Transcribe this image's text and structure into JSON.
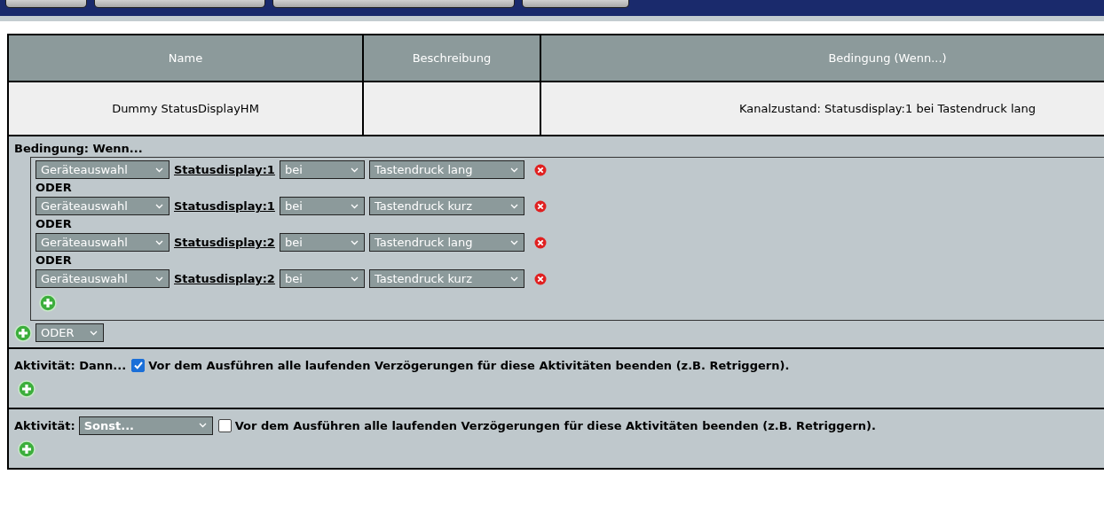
{
  "table": {
    "columns": [
      "Name",
      "Beschreibung",
      "Bedingung (Wenn...)"
    ],
    "rows": [
      {
        "name": "Dummy StatusDisplayHM",
        "condition": "Kanalzustand: Statusdisplay:1 bei Tastendruck lang"
      }
    ]
  },
  "condition": {
    "title": "Bedingung: Wenn...",
    "rules": [
      {
        "device_select": "Geräteauswahl",
        "channel": "Statusdisplay:1",
        "operator": "bei",
        "trigger": "Tastendruck lang"
      },
      {
        "connector": "ODER",
        "device_select": "Geräteauswahl",
        "channel": "Statusdisplay:1",
        "operator": "bei",
        "trigger": "Tastendruck kurz"
      },
      {
        "connector": "ODER",
        "device_select": "Geräteauswahl",
        "channel": "Statusdisplay:2",
        "operator": "bei",
        "trigger": "Tastendruck lang"
      },
      {
        "connector": "ODER",
        "device_select": "Geräteauswahl",
        "channel": "Statusdisplay:2",
        "operator": "bei",
        "trigger": "Tastendruck kurz"
      }
    ],
    "group_operator": "ODER"
  },
  "activities": [
    {
      "label": "Aktivität: Dann...",
      "checked": true,
      "checkbox_label": "Vor dem Ausführen alle laufenden Verzögerungen für diese Aktivitäten beenden (z.B. Retriggern)."
    },
    {
      "label": "Aktivität:",
      "select": "Sonst...",
      "checked": false,
      "checkbox_label": "Vor dem Ausführen alle laufenden Verzögerungen für diese Aktivitäten beenden (z.B. Retriggern)."
    }
  ]
}
